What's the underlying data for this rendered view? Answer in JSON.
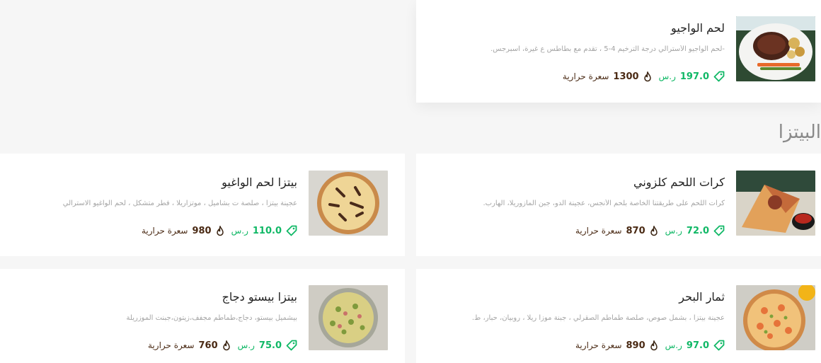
{
  "section": {
    "title": "البيتزا"
  },
  "currency": "ر.س",
  "calorie_unit": "سعرة حرارية",
  "colors": {
    "price": "#10b866",
    "calories": "#4a2a14"
  },
  "items": [
    {
      "title": "لحم الواجيو",
      "description": "-لحم الواجيو الأسترالي درجة الترخيم 4-5 ، تقدم مع بطاطس ع غيرة، اسبرجس.",
      "price": "197.0",
      "calories": "1300",
      "image": "steak-plate"
    },
    {
      "title": "كرات اللحم كلزوني",
      "description": "كرات اللحم على طريقتنا الخاصة بلحم الأنجس، عجينة الدو، جبن المازوريلا، الهارب.",
      "price": "72.0",
      "calories": "870",
      "image": "calzone"
    },
    {
      "title": "بيتزا لحم الواغيو",
      "description": "عجينة بيتزا ، صلصة ت بشاميل ، موتزاريلا ، فطر متشكل ، لحم الواغيو الاسترالي",
      "price": "110.0",
      "calories": "980",
      "image": "wagyu-pizza"
    },
    {
      "title": "ثمار البحر",
      "description": "عجينة بيتزا ، بشمل صوص، صلصة طماطم الصقرلي ، جبنة موزا ريلا ، روبيان، حبار، ط.",
      "price": "97.0",
      "calories": "890",
      "image": "seafood-pizza"
    },
    {
      "title": "بيتزا بيستو دجاج",
      "description": "بيشميل بيستو، دجاج،طماطم مجفف،زيتون،جبنت الموزريلة",
      "price": "75.0",
      "calories": "760",
      "image": "pesto-pizza"
    }
  ]
}
